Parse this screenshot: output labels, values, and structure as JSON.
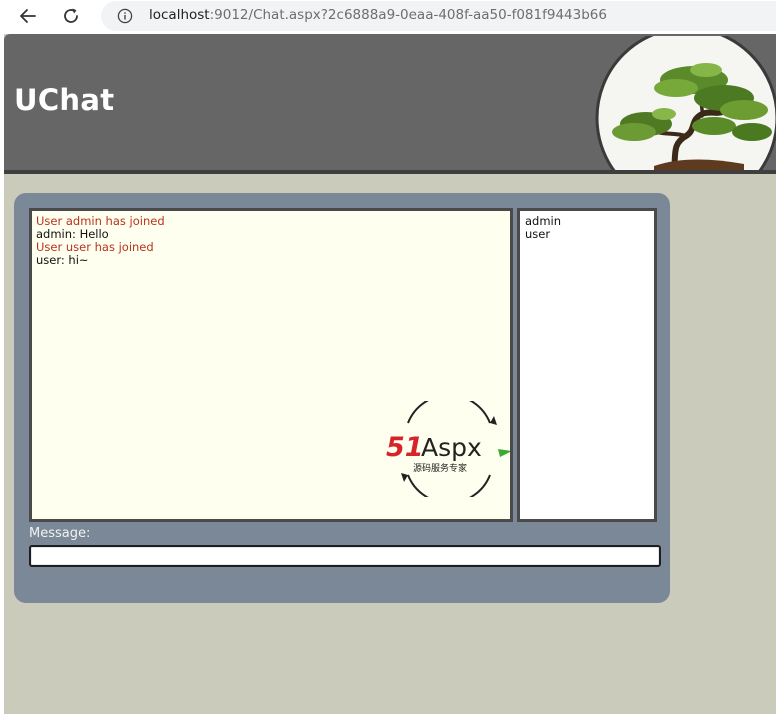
{
  "browser": {
    "url_host": "localhost",
    "url_rest": ":9012/Chat.aspx?2c6888a9-0eaa-408f-aa50-f081f9443b66"
  },
  "header": {
    "title": "UChat"
  },
  "chat": {
    "messages": [
      {
        "type": "system",
        "text": "User admin has joined"
      },
      {
        "type": "user",
        "text": "admin: Hello"
      },
      {
        "type": "system",
        "text": "User user has joined"
      },
      {
        "type": "user",
        "text": "user: hi~"
      }
    ],
    "users": [
      "admin",
      "user"
    ],
    "watermark": {
      "brand_red": "51",
      "brand_dark": "Aspx",
      "tagline": "源码服务专家"
    }
  },
  "compose": {
    "label": "Message:",
    "value": ""
  },
  "colors": {
    "system_message": "#b8331e",
    "header_bg": "#666666",
    "page_bg": "#cbcbbb",
    "panel_bg": "#7b8897",
    "messages_bg": "#fffff0"
  }
}
